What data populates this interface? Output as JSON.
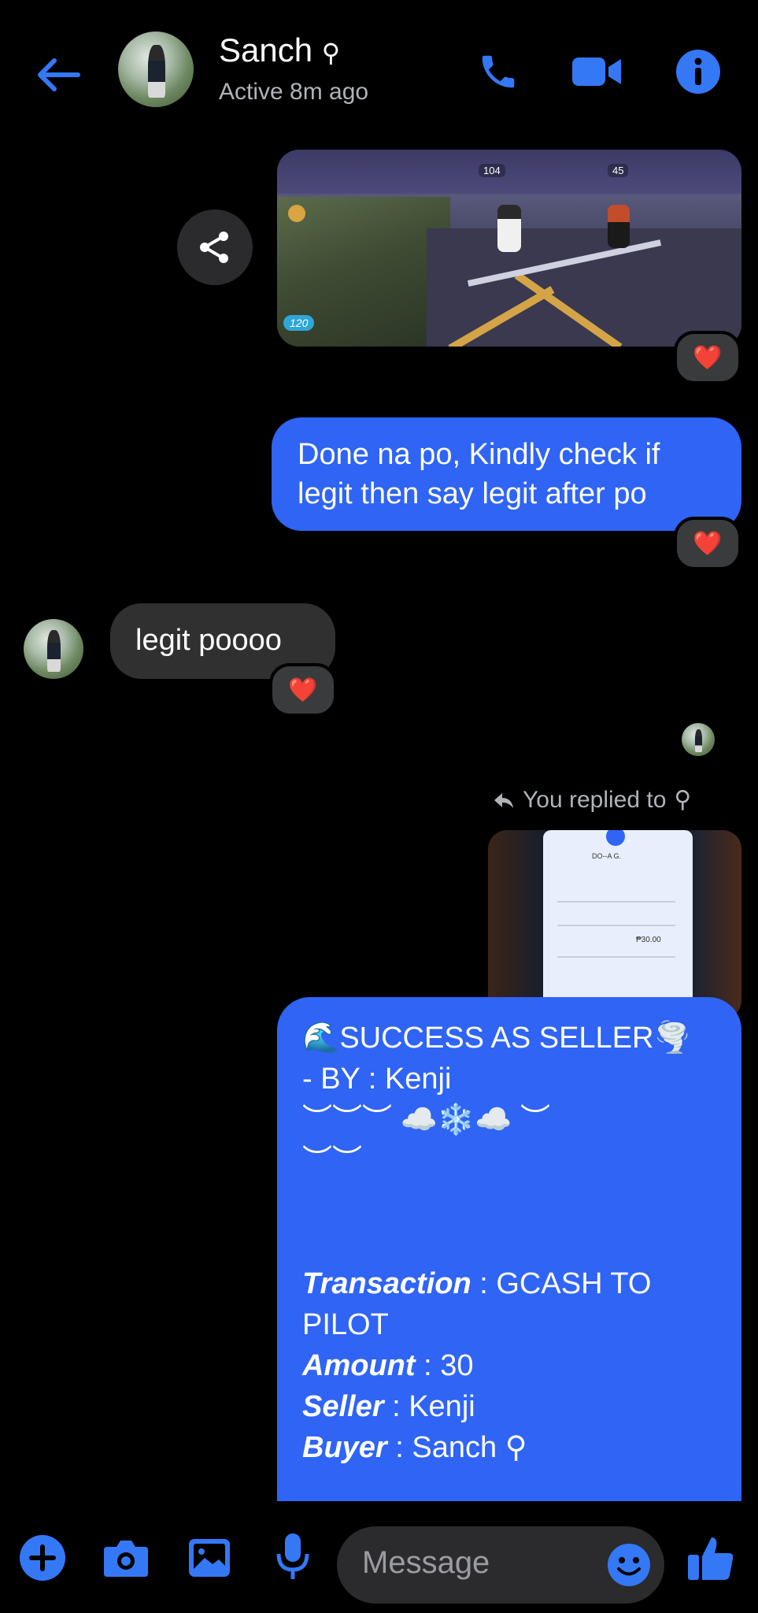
{
  "header": {
    "contact_name": "Sanch",
    "name_glyph": "⚲",
    "status": "Active 8m ago",
    "icons": [
      "back-arrow-icon",
      "phone-icon",
      "video-icon",
      "info-icon"
    ],
    "accent": "#3478f6"
  },
  "messages": {
    "game_screenshot": {
      "hud_count_left": "104",
      "hud_count_right": "45",
      "hud_badge": "120"
    },
    "outgoing_1": "Done na po, Kindly check if legit then say legit after po",
    "incoming_1": "legit poooo",
    "replied_note": "You replied to",
    "replied_glyph": "⚲",
    "receipt": {
      "name": "DO--A G.",
      "amount": "₱30.00"
    },
    "card": {
      "line1": "🌊SUCCESS AS SELLER🌪️",
      "line2": "- BY : Kenji",
      "line3": "︶︶︶ ☁️❄️☁️ ︶",
      "line4": "︶︶",
      "transaction_label": "Transaction",
      "transaction_value": " : GCASH TO",
      "transaction_value_2": "PILOT",
      "amount_label": "Amount",
      "amount_value": " : 30",
      "seller_label": "Seller",
      "seller_value": " : Kenji",
      "buyer_label": "Buyer",
      "buyer_value": " : Sanch ⚲"
    },
    "reaction": "❤️"
  },
  "composer": {
    "placeholder": "Message",
    "icons": [
      "plus-icon",
      "camera-icon",
      "gallery-icon",
      "mic-icon",
      "emoji-icon",
      "thumbs-up-icon"
    ]
  }
}
